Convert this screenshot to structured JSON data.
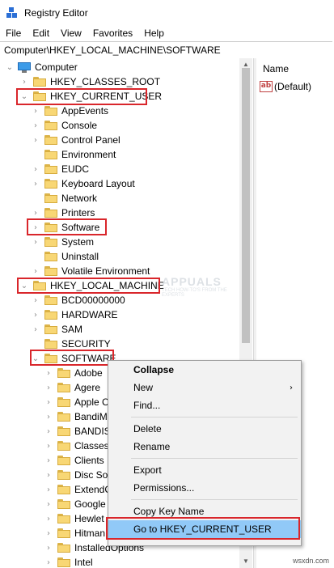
{
  "window": {
    "title": "Registry Editor"
  },
  "menubar": {
    "items": [
      "File",
      "Edit",
      "View",
      "Favorites",
      "Help"
    ]
  },
  "address": {
    "path": "Computer\\HKEY_LOCAL_MACHINE\\SOFTWARE"
  },
  "right_pane": {
    "column_name": "Name",
    "default_value": "(Default)",
    "value_icon": "ab-string-icon"
  },
  "tree": {
    "root": "Computer",
    "items": [
      {
        "label": "HKEY_CLASSES_ROOT",
        "level": 1,
        "expander": "collapsed"
      },
      {
        "label": "HKEY_CURRENT_USER",
        "level": 1,
        "expander": "expanded"
      },
      {
        "label": "AppEvents",
        "level": 2,
        "expander": "collapsed"
      },
      {
        "label": "Console",
        "level": 2,
        "expander": "collapsed"
      },
      {
        "label": "Control Panel",
        "level": 2,
        "expander": "collapsed"
      },
      {
        "label": "Environment",
        "level": 2,
        "expander": "none"
      },
      {
        "label": "EUDC",
        "level": 2,
        "expander": "collapsed"
      },
      {
        "label": "Keyboard Layout",
        "level": 2,
        "expander": "collapsed"
      },
      {
        "label": "Network",
        "level": 2,
        "expander": "none"
      },
      {
        "label": "Printers",
        "level": 2,
        "expander": "collapsed"
      },
      {
        "label": "Software",
        "level": 2,
        "expander": "collapsed"
      },
      {
        "label": "System",
        "level": 2,
        "expander": "collapsed"
      },
      {
        "label": "Uninstall",
        "level": 2,
        "expander": "none"
      },
      {
        "label": "Volatile Environment",
        "level": 2,
        "expander": "collapsed"
      },
      {
        "label": "HKEY_LOCAL_MACHINE",
        "level": 1,
        "expander": "expanded"
      },
      {
        "label": "BCD00000000",
        "level": 2,
        "expander": "collapsed"
      },
      {
        "label": "HARDWARE",
        "level": 2,
        "expander": "collapsed"
      },
      {
        "label": "SAM",
        "level": 2,
        "expander": "collapsed"
      },
      {
        "label": "SECURITY",
        "level": 2,
        "expander": "none"
      },
      {
        "label": "SOFTWARE",
        "level": 2,
        "expander": "expanded"
      },
      {
        "label": "Adobe",
        "level": 3,
        "expander": "collapsed"
      },
      {
        "label": "Agere",
        "level": 3,
        "expander": "collapsed"
      },
      {
        "label": "Apple C",
        "level": 3,
        "expander": "collapsed"
      },
      {
        "label": "BandiM",
        "level": 3,
        "expander": "collapsed"
      },
      {
        "label": "BANDIS",
        "level": 3,
        "expander": "collapsed"
      },
      {
        "label": "Classes",
        "level": 3,
        "expander": "collapsed"
      },
      {
        "label": "Clients",
        "level": 3,
        "expander": "collapsed"
      },
      {
        "label": "Disc So",
        "level": 3,
        "expander": "collapsed"
      },
      {
        "label": "ExtendC",
        "level": 3,
        "expander": "collapsed"
      },
      {
        "label": "Google",
        "level": 3,
        "expander": "collapsed"
      },
      {
        "label": "Hewlet",
        "level": 3,
        "expander": "collapsed"
      },
      {
        "label": "Hitman",
        "level": 3,
        "expander": "collapsed"
      },
      {
        "label": "InstalledOptions",
        "level": 3,
        "expander": "collapsed"
      },
      {
        "label": "Intel",
        "level": 3,
        "expander": "collapsed"
      }
    ]
  },
  "context_menu": {
    "items": [
      {
        "label": "Collapse",
        "bold": true,
        "submenu": false
      },
      {
        "label": "New",
        "bold": false,
        "submenu": true
      },
      {
        "label": "Find...",
        "bold": false,
        "submenu": false
      },
      {
        "label": "Delete",
        "bold": false,
        "submenu": false
      },
      {
        "label": "Rename",
        "bold": false,
        "submenu": false
      },
      {
        "label": "Export",
        "bold": false,
        "submenu": false
      },
      {
        "label": "Permissions...",
        "bold": false,
        "submenu": false
      },
      {
        "label": "Copy Key Name",
        "bold": false,
        "submenu": false
      },
      {
        "label": "Go to HKEY_CURRENT_USER",
        "bold": false,
        "submenu": false,
        "selected": true
      }
    ]
  },
  "watermark": {
    "brand": "APPUALS",
    "tagline": "TECH HOW-TO'S FROM THE EXPERTS",
    "site": "wsxdn.com"
  },
  "colors": {
    "highlight_border": "#d9262b",
    "menu_selected": "#91c9f7",
    "folder": "#f8d775"
  }
}
